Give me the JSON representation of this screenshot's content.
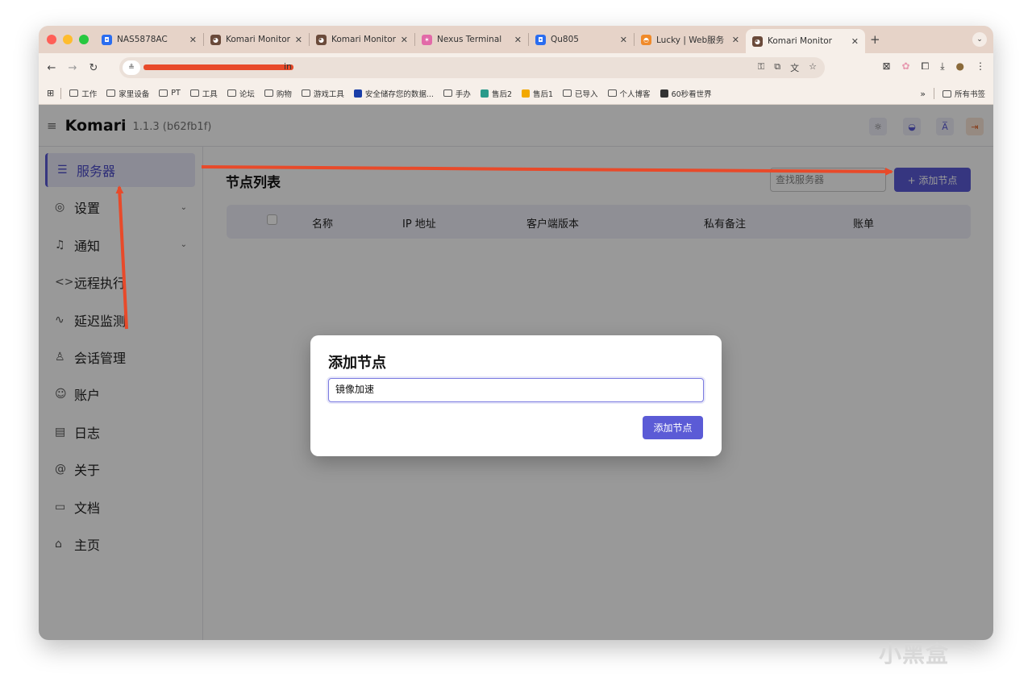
{
  "browser": {
    "tabs": [
      {
        "title": "NAS5878AC",
        "fav_color": "#2a6df0",
        "fav_glyph": "◘"
      },
      {
        "title": "Komari Monitor",
        "fav_color": "#6a4a3a",
        "fav_glyph": "◕"
      },
      {
        "title": "Komari Monitor",
        "fav_color": "#6a4a3a",
        "fav_glyph": "◕"
      },
      {
        "title": "Nexus Terminal",
        "fav_color": "#e26aa8",
        "fav_glyph": "✶"
      },
      {
        "title": "Qu805",
        "fav_color": "#2a6df0",
        "fav_glyph": "◘"
      },
      {
        "title": "Lucky | Web服务",
        "fav_color": "#f08a2a",
        "fav_glyph": "◓"
      }
    ],
    "active_tab": {
      "title": "Komari Monitor",
      "fav_color": "#6a4a3a",
      "fav_glyph": "◕"
    },
    "url_tail": "in",
    "bookmarks": [
      {
        "label": "工作",
        "kind": "folder"
      },
      {
        "label": "家里设备",
        "kind": "folder"
      },
      {
        "label": "PT",
        "kind": "folder"
      },
      {
        "label": "工具",
        "kind": "folder"
      },
      {
        "label": "论坛",
        "kind": "folder"
      },
      {
        "label": "购物",
        "kind": "folder"
      },
      {
        "label": "游戏工具",
        "kind": "folder"
      },
      {
        "label": "安全储存您的数据...",
        "kind": "site",
        "color": "#1a3ea8"
      },
      {
        "label": "手办",
        "kind": "folder"
      },
      {
        "label": "售后2",
        "kind": "site",
        "color": "#2a9a8a"
      },
      {
        "label": "售后1",
        "kind": "site",
        "color": "#f2a800"
      },
      {
        "label": "已导入",
        "kind": "folder"
      },
      {
        "label": "个人博客",
        "kind": "folder"
      },
      {
        "label": "60秒看世界",
        "kind": "site",
        "color": "#333333"
      }
    ],
    "bookmarks_more": "»",
    "all_bookmarks": "所有书签"
  },
  "app": {
    "brand": "Komari",
    "version": "1.1.3 (b62fb1f)",
    "sidebar": [
      {
        "label": "服务器",
        "icon": "server-icon",
        "glyph": "☰",
        "active": true,
        "chevron": false
      },
      {
        "label": "设置",
        "icon": "settings-icon",
        "glyph": "◎",
        "active": false,
        "chevron": true
      },
      {
        "label": "通知",
        "icon": "bell-icon",
        "glyph": "♫",
        "active": false,
        "chevron": true
      },
      {
        "label": "远程执行",
        "icon": "code-icon",
        "glyph": "<>",
        "active": false,
        "chevron": false
      },
      {
        "label": "延迟监测",
        "icon": "pulse-icon",
        "glyph": "∿",
        "active": false,
        "chevron": false
      },
      {
        "label": "会话管理",
        "icon": "users-icon",
        "glyph": "♙",
        "active": false,
        "chevron": false
      },
      {
        "label": "账户",
        "icon": "account-icon",
        "glyph": "☺",
        "active": false,
        "chevron": false
      },
      {
        "label": "日志",
        "icon": "log-icon",
        "glyph": "▤",
        "active": false,
        "chevron": false
      },
      {
        "label": "关于",
        "icon": "at-icon",
        "glyph": "@",
        "active": false,
        "chevron": false
      },
      {
        "label": "文档",
        "icon": "book-icon",
        "glyph": "▭",
        "active": false,
        "chevron": false
      },
      {
        "label": "主页",
        "icon": "home-icon",
        "glyph": "⌂",
        "active": false,
        "chevron": false
      }
    ],
    "main": {
      "title": "节点列表",
      "search_placeholder": "查找服务器",
      "add_button": "+ 添加节点",
      "columns": [
        "名称",
        "IP 地址",
        "客户端版本",
        "私有备注",
        "账单"
      ]
    },
    "dialog": {
      "title": "添加节点",
      "input_value": "镜像加速",
      "confirm": "添加节点"
    }
  },
  "colors": {
    "accent": "#5b5bd6",
    "annotation": "#e84a2a"
  },
  "watermark": "小黑盒"
}
